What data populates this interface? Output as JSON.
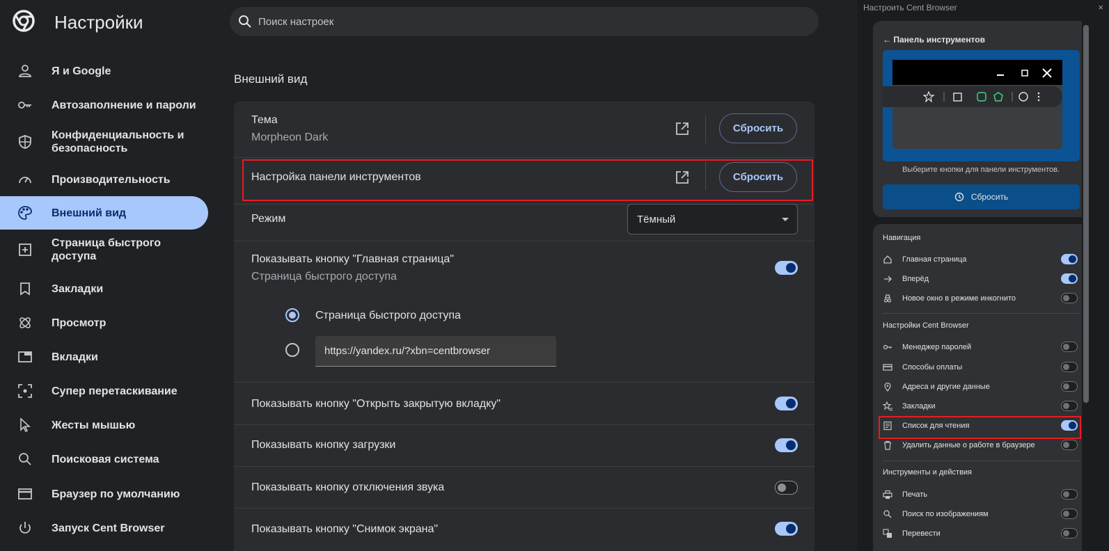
{
  "app": {
    "title": "Настройки"
  },
  "search": {
    "placeholder": "Поиск настроек"
  },
  "sidebar": {
    "items": [
      {
        "label": "Я и Google",
        "icon": "person-icon"
      },
      {
        "label": "Автозаполнение и пароли",
        "icon": "key-icon"
      },
      {
        "label": "Конфиденциальность и безопасность",
        "icon": "shield-icon"
      },
      {
        "label": "Производительность",
        "icon": "speedometer-icon"
      },
      {
        "label": "Внешний вид",
        "icon": "palette-icon",
        "active": true
      },
      {
        "label": "Страница быстрого доступа",
        "icon": "add-box-icon"
      },
      {
        "label": "Закладки",
        "icon": "bookmark-icon"
      },
      {
        "label": "Просмотр",
        "icon": "atom-icon"
      },
      {
        "label": "Вкладки",
        "icon": "tab-icon"
      },
      {
        "label": "Супер перетаскивание",
        "icon": "drag-select-icon"
      },
      {
        "label": "Жесты мышью",
        "icon": "cursor-icon"
      },
      {
        "label": "Поисковая система",
        "icon": "search-icon"
      },
      {
        "label": "Браузер по умолчанию",
        "icon": "browser-window-icon"
      },
      {
        "label": "Запуск Cent Browser",
        "icon": "power-icon"
      }
    ]
  },
  "appearance": {
    "section_title": "Внешний вид",
    "theme": {
      "label": "Тема",
      "value": "Morpheon Dark",
      "reset": "Сбросить"
    },
    "toolbar": {
      "label": "Настройка панели инструментов",
      "reset": "Сбросить"
    },
    "mode": {
      "label": "Режим",
      "value": "Тёмный"
    },
    "home_button": {
      "label": "Показывать кнопку \"Главная страница\"",
      "sub": "Страница быстрого доступа",
      "enabled": true,
      "option_ntp": "Страница быстрого доступа",
      "option_url": "https://yandex.ru/?xbn=centbrowser"
    },
    "toggles": [
      {
        "label": "Показывать кнопку \"Открыть закрытую вкладку\"",
        "on": true
      },
      {
        "label": "Показывать кнопку загрузки",
        "on": true
      },
      {
        "label": "Показывать кнопку отключения звука",
        "on": false
      },
      {
        "label": "Показывать кнопку \"Снимок экрана\"",
        "on": true
      }
    ]
  },
  "panel": {
    "window_title": "Настроить Cent Browser",
    "close": "×",
    "back_label": "Панель инструментов",
    "hint": "Выберите кнопки для панели инструментов.",
    "reset": "Сбросить",
    "groups": [
      {
        "title": "Навигация",
        "items": [
          {
            "label": "Главная страница",
            "icon": "home-icon",
            "on": true
          },
          {
            "label": "Вперёд",
            "icon": "arrow-right-icon",
            "on": true
          },
          {
            "label": "Новое окно в режиме инкогнито",
            "icon": "incognito-icon",
            "on": false
          }
        ]
      },
      {
        "title": "Настройки Cent Browser",
        "items": [
          {
            "label": "Менеджер паролей",
            "icon": "key-icon",
            "on": false
          },
          {
            "label": "Способы оплаты",
            "icon": "credit-card-icon",
            "on": false
          },
          {
            "label": "Адреса и другие данные",
            "icon": "location-pin-icon",
            "on": false
          },
          {
            "label": "Закладки",
            "icon": "star-list-icon",
            "on": false
          },
          {
            "label": "Список для чтения",
            "icon": "reading-list-icon",
            "on": true
          },
          {
            "label": "Удалить данные о работе в браузере",
            "icon": "trash-icon",
            "on": false
          }
        ]
      },
      {
        "title": "Инструменты и действия",
        "items": [
          {
            "label": "Печать",
            "icon": "print-icon",
            "on": false
          },
          {
            "label": "Поиск по изображениям",
            "icon": "search-icon",
            "on": false
          },
          {
            "label": "Перевести",
            "icon": "translate-icon",
            "on": false
          }
        ]
      }
    ]
  },
  "colors": {
    "accent": "#a8c7fa",
    "highlight": "#e81b23",
    "panel_button": "#0b4f8a"
  }
}
